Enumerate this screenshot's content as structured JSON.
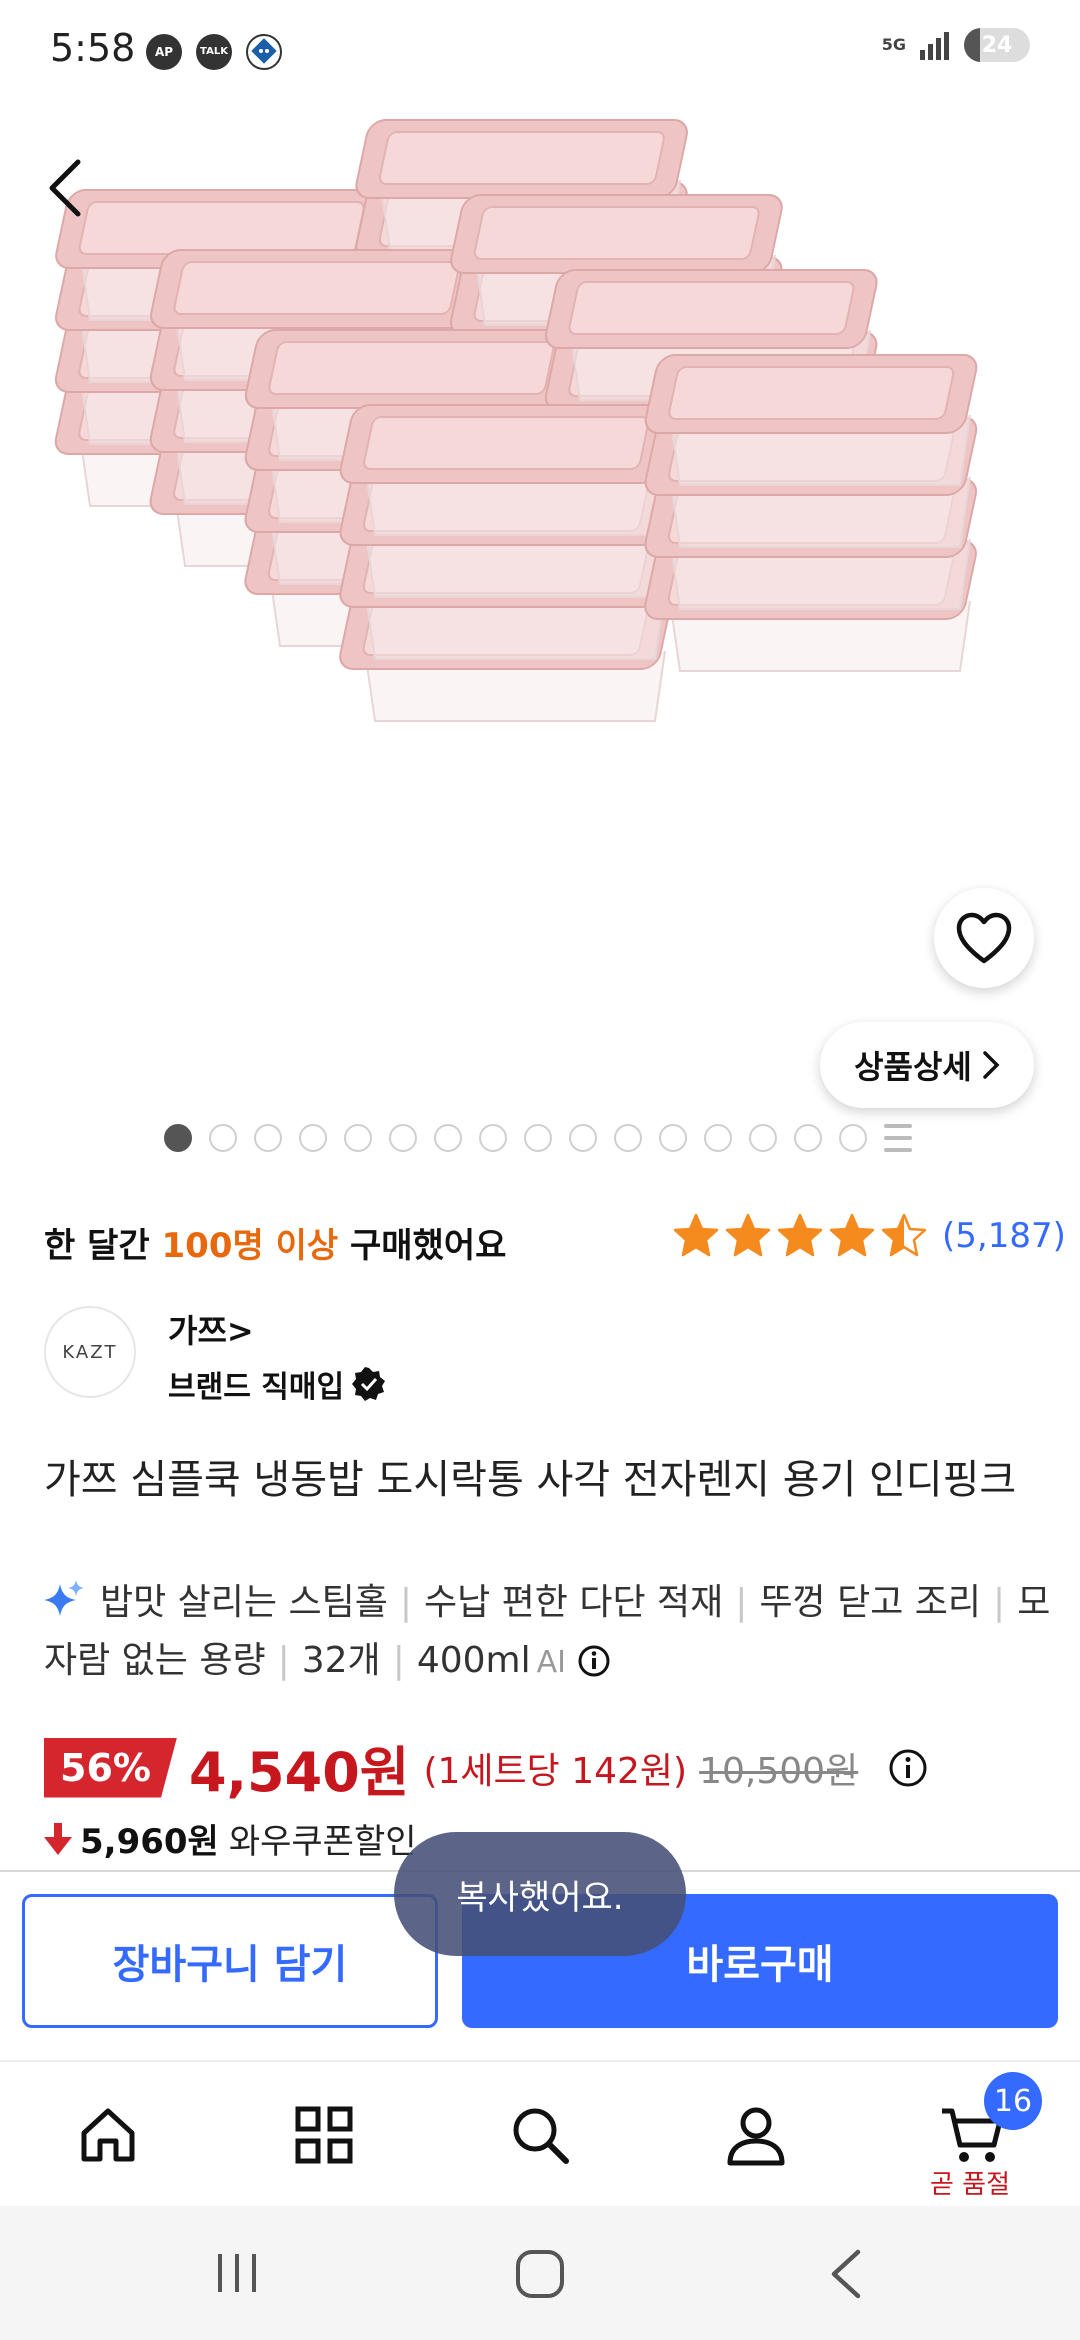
{
  "status_bar": {
    "time": "5:58",
    "app_icons": [
      "AP",
      "TALK",
      "domino"
    ],
    "network": "5G",
    "battery": "24",
    "battery_level": 0.24
  },
  "product_image": {
    "back_icon": "chevron-left-icon",
    "wishlist_icon": "heart-outline-icon",
    "detail_button_label": "상품상세",
    "page_indicator": {
      "total_dots": 16,
      "active_index": 0
    }
  },
  "purchase_info": {
    "prefix": "한 달간 ",
    "highlight": "100명 이상",
    "suffix": " 구매했어요",
    "rating_value": 4.5,
    "rating_max": 5,
    "review_count": "(5,187)"
  },
  "brand": {
    "logo_text": "KAZT",
    "name": "가쯔>",
    "direct_label": "브랜드 직매입"
  },
  "product": {
    "title": "가쯔 심플쿡 냉동밥 도시락통 사각 전자렌지 용기 인디핑크",
    "tags": [
      "밥맛 살리는 스팀홀",
      "수납 편한 다단 적재",
      "뚜껑 닫고 조리",
      "모자람 없는 용량",
      "32개",
      "400ml"
    ],
    "ai_label": "AI"
  },
  "price": {
    "discount": "56%",
    "sale_price": "4,540원",
    "unit_price": "(1세트당 142원)",
    "original_price": "10,500원",
    "coupon_price": "5,960원",
    "coupon_label": "와우쿠폰할인"
  },
  "actions": {
    "cart_label": "장바구니 담기",
    "buy_label": "바로구매",
    "toast": "복사했어요."
  },
  "bottom_nav": {
    "items": [
      "home-icon",
      "category-grid-icon",
      "search-icon",
      "account-icon",
      "cart-icon"
    ],
    "cart_badge": "16",
    "cart_caption": "곧 품절"
  },
  "colors": {
    "accent_blue": "#346aff",
    "price_red": "#c7171e",
    "highlight_orange": "#e8690d",
    "star_orange": "#f58a1f",
    "lid_pink": "#efc4c4"
  }
}
